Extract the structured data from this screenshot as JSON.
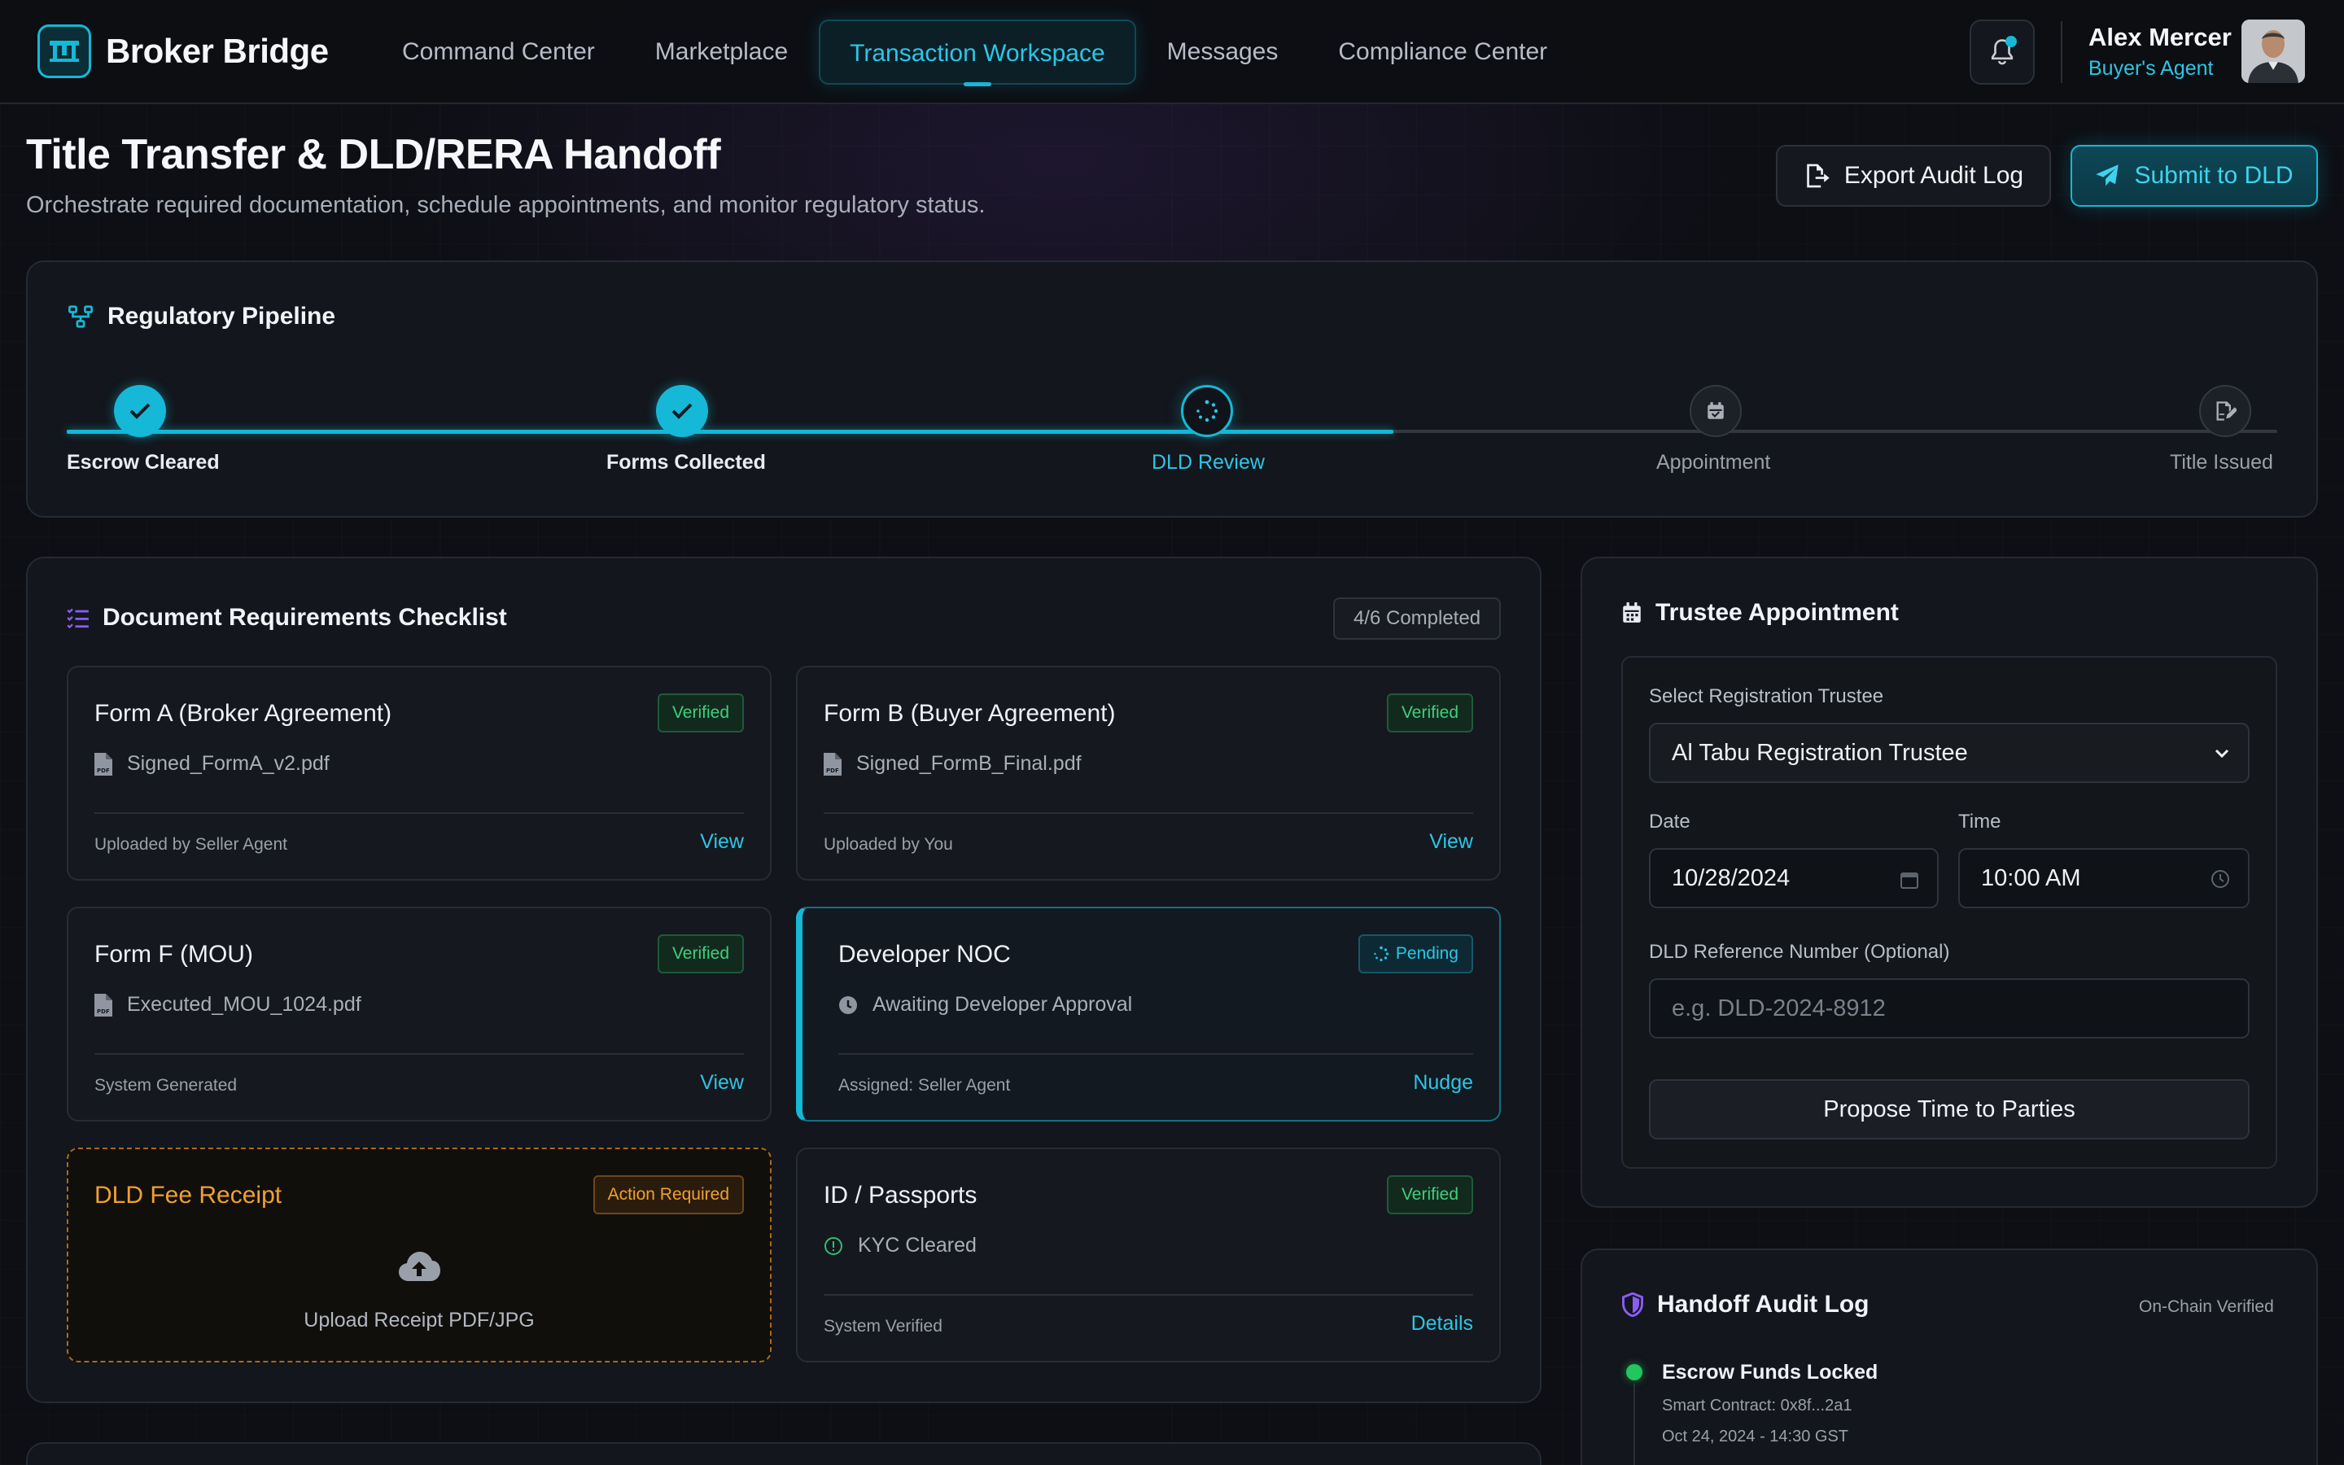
{
  "app": {
    "brand": "Broker Bridge",
    "nav": [
      {
        "label": "Command Center"
      },
      {
        "label": "Marketplace"
      },
      {
        "label": "Transaction Workspace"
      },
      {
        "label": "Messages"
      },
      {
        "label": "Compliance Center"
      }
    ],
    "active_nav": "Transaction Workspace",
    "user": {
      "name": "Alex Mercer",
      "role": "Buyer's Agent"
    },
    "accent_color": "#15b8d6"
  },
  "page": {
    "title": "Title Transfer & DLD/RERA Handoff",
    "subtitle": "Orchestrate required documentation, schedule appointments, and monitor regulatory status.",
    "export_label": "Export Audit Log",
    "submit_label": "Submit to DLD"
  },
  "pipeline": {
    "title": "Regulatory Pipeline",
    "steps": [
      {
        "label": "Escrow Cleared",
        "state": "done"
      },
      {
        "label": "Forms Collected",
        "state": "done"
      },
      {
        "label": "DLD Review",
        "state": "current"
      },
      {
        "label": "Appointment",
        "state": "todo"
      },
      {
        "label": "Title Issued",
        "state": "todo"
      }
    ]
  },
  "checklist": {
    "title": "Document Requirements Checklist",
    "counter": "4/6 Completed",
    "cards": [
      {
        "title": "Form A (Broker Agreement)",
        "badge": "Verified",
        "file": "Signed_FormA_v2.pdf",
        "foot": "Uploaded by Seller Agent",
        "link": "View"
      },
      {
        "title": "Form B (Buyer Agreement)",
        "badge": "Verified",
        "file": "Signed_FormB_Final.pdf",
        "foot": "Uploaded by You",
        "link": "View"
      },
      {
        "title": "Form F (MOU)",
        "badge": "Verified",
        "file": "Executed_MOU_1024.pdf",
        "foot": "System Generated",
        "link": "View"
      },
      {
        "title": "Developer NOC",
        "badge": "Pending",
        "file": "Awaiting Developer Approval",
        "foot": "Assigned: Seller Agent",
        "link": "Nudge"
      },
      {
        "title": "DLD Fee Receipt",
        "badge": "Action Required",
        "upload": "Upload Receipt PDF/JPG"
      },
      {
        "title": "ID / Passports",
        "badge": "Verified",
        "file": "KYC Cleared",
        "foot": "System Verified",
        "link": "Details"
      }
    ]
  },
  "trustee": {
    "title": "Trustee Appointment",
    "select_label": "Select Registration Trustee",
    "select_value": "Al Tabu Registration Trustee",
    "date_label": "Date",
    "date_value": "10/28/2024",
    "time_label": "Time",
    "time_value": "10:00 AM",
    "ref_label": "DLD Reference Number (Optional)",
    "ref_placeholder": "e.g. DLD-2024-8912",
    "propose_label": "Propose Time to Parties"
  },
  "audit": {
    "title": "Handoff Audit Log",
    "badge": "On-Chain Verified",
    "entries": [
      {
        "title": "Escrow Funds Locked",
        "meta1": "Smart Contract: 0x8f...2a1",
        "meta2": "Oct 24, 2024 - 14:30 GST"
      }
    ]
  }
}
